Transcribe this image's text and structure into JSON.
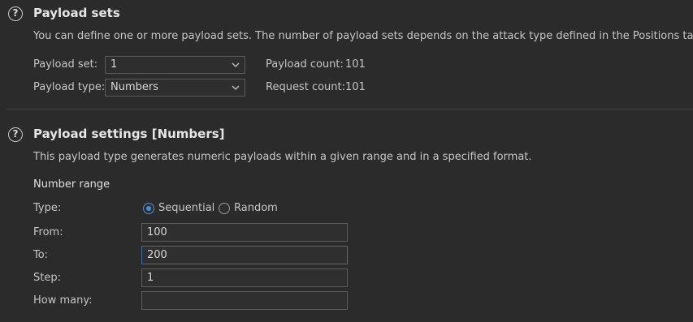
{
  "payload_sets": {
    "title": "Payload sets",
    "description": "You can define one or more payload sets. The number of payload sets depends on the attack type defined in the Positions tab. Various",
    "payload_set_label": "Payload set:",
    "payload_set_value": "1",
    "payload_type_label": "Payload type:",
    "payload_type_value": "Numbers",
    "payload_count_label": "Payload count:",
    "payload_count_value": "101",
    "request_count_label": "Request count:",
    "request_count_value": "101"
  },
  "payload_settings": {
    "title": "Payload settings [Numbers]",
    "description": "This payload type generates numeric payloads within a given range and in a specified format.",
    "number_range_heading": "Number range",
    "type_label": "Type:",
    "sequential_label": "Sequential",
    "random_label": "Random",
    "selected_type": "Sequential",
    "from_label": "From:",
    "from_value": "100",
    "to_label": "To:",
    "to_value": "200",
    "step_label": "Step:",
    "step_value": "1",
    "how_many_label": "How many:",
    "how_many_value": ""
  },
  "colors": {
    "background": "#2b2b2b",
    "accent": "#4a8fd6"
  },
  "icons": [
    "help-icon",
    "chevron-down-icon"
  ]
}
